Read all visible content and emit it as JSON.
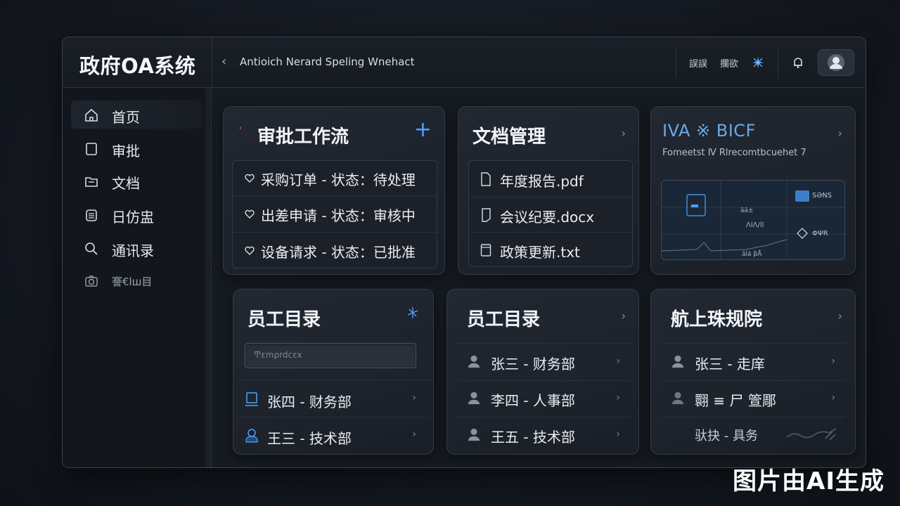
{
  "app": {
    "title": "政府OA系统",
    "breadcrumb": "Antioich Nerard Speling Wnehact"
  },
  "topbar": {
    "items": [
      "誤誤",
      "攔欲"
    ],
    "icons": [
      "sparkle-icon",
      "bell-icon",
      "user-avatar"
    ]
  },
  "sidebar": {
    "items": [
      {
        "label": "首页",
        "icon": "home-icon"
      },
      {
        "label": "审批",
        "icon": "tablet-icon"
      },
      {
        "label": "文档",
        "icon": "folder-icon"
      },
      {
        "label": "日仿盅",
        "icon": "calendar-icon"
      },
      {
        "label": "通讯录",
        "icon": "search-icon"
      },
      {
        "label": "謇€lш目",
        "icon": "camera-icon"
      }
    ]
  },
  "cards": {
    "workflow": {
      "title": "审批工作流",
      "rows": [
        "采购订单 - 状态：待处理",
        "出差申请 - 状态：审核中",
        "设备请求 - 状态：已批准"
      ]
    },
    "documents": {
      "title": "文档管理",
      "rows": [
        "年度报告.pdf",
        "会议纪要.docx",
        "政策更新.txt"
      ]
    },
    "analytics": {
      "title": "IVA ※ BICF",
      "subtitle": "Fomeetst Ⅳ  Rlrecomtbcuehet 7",
      "chart_labels": [
        "ãã±",
        "ΛlΛ/ll",
        "ãlá βÅ"
      ],
      "legend": [
        "SƏNS",
        "ΦΨR"
      ]
    },
    "directory1": {
      "title": "员工目录",
      "search_placeholder": "Ͳεmρrdcεx",
      "rows": [
        "张四 - 财务部",
        "王三 - 技术部"
      ]
    },
    "directory2": {
      "title": "员工目录",
      "rows": [
        "张三 - 财务部",
        "李四 - 人事部",
        "王五 - 技术部"
      ]
    },
    "directory3": {
      "title": "航上珠规院",
      "rows": [
        "张三 - 走庠",
        "翾 ≡ 尸 箮郮",
        "驮抉 - 具务"
      ]
    }
  },
  "watermark": "图片由AI生成"
}
